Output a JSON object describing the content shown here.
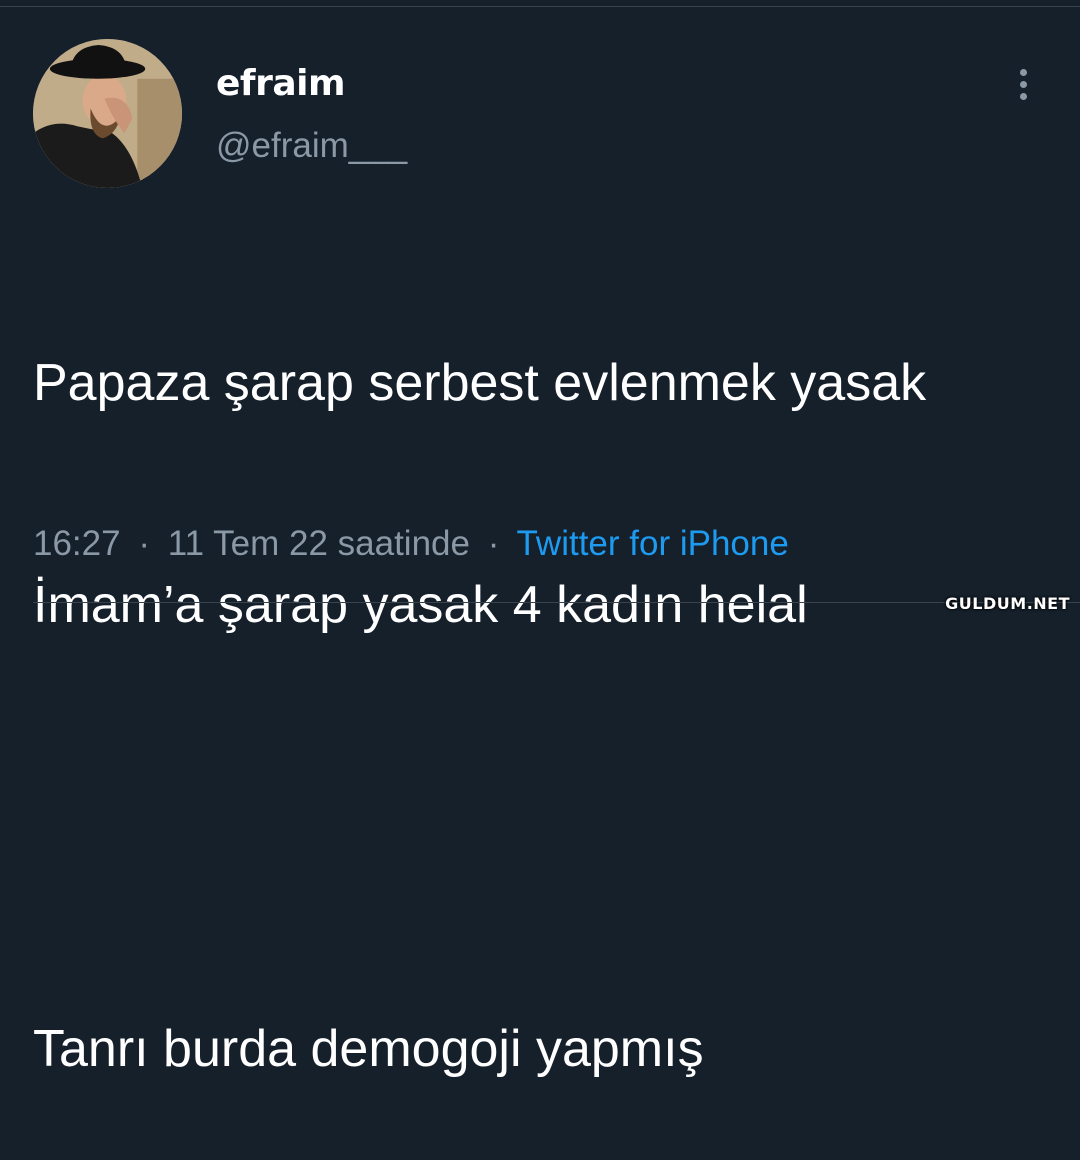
{
  "author": {
    "display_name": "efraim",
    "handle": "@efraim___"
  },
  "more_icon": "more-vertical-icon",
  "tweet": {
    "lines": [
      "Papaza şarap serbest evlenmek yasak",
      "İmam’a şarap yasak 4 kadın helal",
      "",
      "Tanrı burda demogoji yapmış"
    ]
  },
  "meta": {
    "time": "16:27",
    "separator": "·",
    "date": "11 Tem 22 saatinde",
    "source": "Twitter for iPhone"
  },
  "watermark": "GULDUM.NET",
  "colors": {
    "background": "#15202b",
    "secondary_text": "#8b98a5",
    "link": "#1d9bf0"
  }
}
